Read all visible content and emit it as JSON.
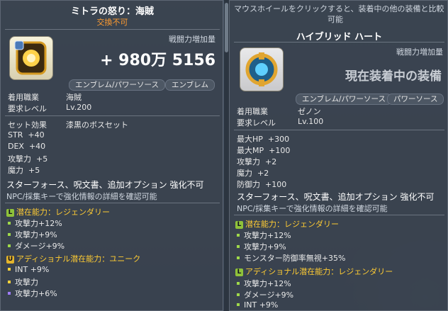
{
  "left": {
    "title": "ミトラの怒り：海賊",
    "untradeable": "交換不可",
    "atk_increase_label": "戦闘力増加量",
    "atk_increase_value": "+ 980万 5156",
    "tag_emblem_powersource": "エンブレム/パワーソース",
    "tag_emblem": "エンブレム",
    "job_label": "着用職業",
    "job_value": "海賊",
    "level_label": "要求レベル",
    "level_value": "Lv.200",
    "set_label": "セット効果",
    "set_value": "漆黒のボスセット",
    "stats": [
      {
        "name": "STR",
        "value": "+40"
      },
      {
        "name": "DEX",
        "value": "+40"
      },
      {
        "name": "攻撃力",
        "value": "+5"
      },
      {
        "name": "魔力",
        "value": "+5"
      }
    ],
    "notice": "スターフォース、呪文書、追加オプション 強化不可",
    "notice_sub": "NPC/採集キーで強化情報の詳細を確認可能",
    "potential_title": "潜在能力：レジェンダリー",
    "potential": [
      "攻撃力+12%",
      "攻撃力+9%",
      "ダメージ+9%"
    ],
    "add_potential_title": "アディショナル潜在能力：ユニーク",
    "add_potential": [
      "INT +9%",
      "攻撃力",
      "攻撃力+6%"
    ]
  },
  "right": {
    "hint1": "マウスホイールをクリックすると、装着中の他の装備と比較",
    "hint2": "可能",
    "title": "ハイブリッド ハート",
    "atk_increase_label": "戦闘力増加量",
    "equipped_label": "現在装着中の装備",
    "tag_emblem_powersource": "エンブレム/パワーソース",
    "tag_powersource": "パワーソース",
    "job_label": "着用職業",
    "job_value": "ゼノン",
    "level_label": "要求レベル",
    "level_value": "Lv.100",
    "stats": [
      {
        "name": "最大HP",
        "value": "+300"
      },
      {
        "name": "最大MP",
        "value": "+100"
      },
      {
        "name": "攻撃力",
        "value": "+2"
      },
      {
        "name": "魔力",
        "value": "+2"
      },
      {
        "name": "防御力",
        "value": "+100"
      }
    ],
    "notice": "スターフォース、呪文書、追加オプション 強化不可",
    "notice_sub": "NPC/採集キーで強化情報の詳細を確認可能",
    "potential_title": "潜在能力：レジェンダリー",
    "potential": [
      "攻撃力+12%",
      "攻撃力+9%",
      "モンスター防御率無視+35%"
    ],
    "add_potential_title": "アディショナル潜在能力：レジェンダリー",
    "add_potential": [
      "攻撃力+12%",
      "ダメージ+9%",
      "INT +9%"
    ]
  }
}
